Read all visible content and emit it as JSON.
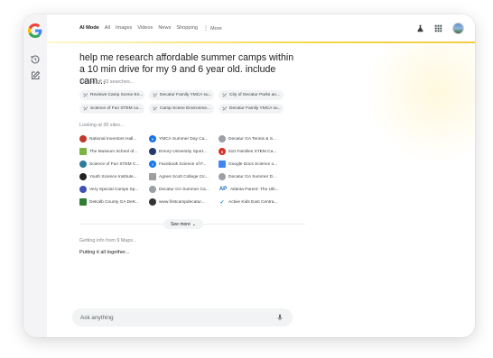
{
  "tabs": [
    {
      "label": "AI Mode",
      "active": true
    },
    {
      "label": "All"
    },
    {
      "label": "Images"
    },
    {
      "label": "Videos"
    },
    {
      "label": "News"
    },
    {
      "label": "Shopping"
    },
    {
      "label": "More"
    }
  ],
  "query": "help me research affordable summer camps within a 10 min drive for my 9 and 6 year old. include cam...",
  "kicking_off": {
    "prefix": "Kicking off",
    "count": "43 searches..."
  },
  "searches": [
    "Reviews Camp Scene En...",
    "Decatur Family YMCA su...",
    "City of Decatur Parks an...",
    "Science of Fun STEM ca...",
    "Camp Scene Environme...",
    "Decatur Family YMCA su..."
  ],
  "looking_at": {
    "prefix": "Looking at",
    "count": "36 sites..."
  },
  "sites": [
    {
      "label": "National Inventors Hall...",
      "icon": "ni-seal",
      "color": "#c0392b"
    },
    {
      "label": "YMCA Summer Day Ca...",
      "icon": "ymca",
      "color": "#1a73e8"
    },
    {
      "label": "Decatur GA Tennis & S...",
      "icon": "decatur-city",
      "color": "#5f6368"
    },
    {
      "label": "The Museum School of...",
      "icon": "museum",
      "color": "#7cb342"
    },
    {
      "label": "Emory University Sport...",
      "icon": "emory",
      "color": "#1f3a6b"
    },
    {
      "label": "510 Families STEM Ca...",
      "icon": "510",
      "color": "#d93025"
    },
    {
      "label": "Science of Fun STEM C...",
      "icon": "sof",
      "color": "#2e7d9a"
    },
    {
      "label": "Facebook Science of F...",
      "icon": "facebook",
      "color": "#1877f2"
    },
    {
      "label": "Google Docs Science o...",
      "icon": "docs",
      "color": "#4285f4"
    },
    {
      "label": "Youth Science Institute...",
      "icon": "ysi",
      "color": "#222222"
    },
    {
      "label": "Agnes Scott College Cir...",
      "icon": "agnes",
      "color": "#6d6d6d"
    },
    {
      "label": "Decatur GA Summer D...",
      "icon": "decatur-city",
      "color": "#5f6368"
    },
    {
      "label": "Very Special Camps Sp...",
      "icon": "vsc",
      "color": "#3f51b5"
    },
    {
      "label": "Decatur GA Summer Ca...",
      "icon": "decatur-city",
      "color": "#5f6368"
    },
    {
      "label": "Atlanta Parent: The Ulti...",
      "icon": "ap",
      "color": "#1565c0"
    },
    {
      "label": "DeKalb County GA DeK...",
      "icon": "dekalb",
      "color": "#2e7d32"
    },
    {
      "label": "www.firstcampdecatur...",
      "icon": "fcd",
      "color": "#333333"
    },
    {
      "label": "Active Kids East Centra...",
      "icon": "activekids",
      "color": "#0288d1"
    }
  ],
  "see_more": "See more",
  "getting_info": {
    "prefix": "Getting info from",
    "count": "9 Maps..."
  },
  "putting_together": "Putting it all together...",
  "ask_placeholder": "Ask anything"
}
